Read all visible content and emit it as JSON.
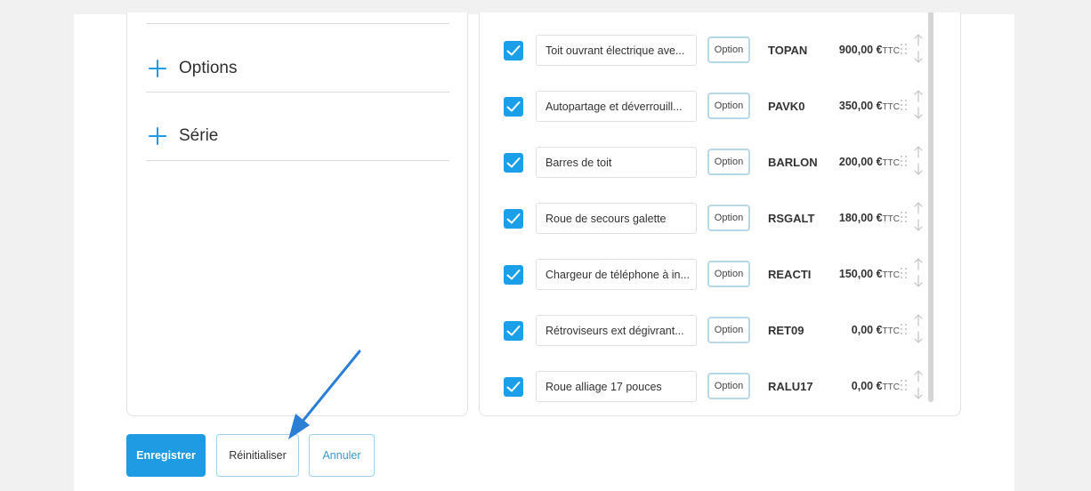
{
  "accordion": [
    {
      "label": "Options"
    },
    {
      "label": "Série"
    }
  ],
  "equipments": [
    {
      "checked": true,
      "name": "Toit ouvrant électrique ave...",
      "type": "Option",
      "code": "TOPAN",
      "price": "900,00 €",
      "unit": "TTC"
    },
    {
      "checked": true,
      "name": "Autopartage et déverrouill...",
      "type": "Option",
      "code": "PAVK0",
      "price": "350,00 €",
      "unit": "TTC"
    },
    {
      "checked": true,
      "name": "Barres de toit",
      "type": "Option",
      "code": "BARLON",
      "price": "200,00 €",
      "unit": "TTC"
    },
    {
      "checked": true,
      "name": "Roue de secours galette",
      "type": "Option",
      "code": "RSGALT",
      "price": "180,00 €",
      "unit": "TTC"
    },
    {
      "checked": true,
      "name": "Chargeur de téléphone à in...",
      "type": "Option",
      "code": "REACTI",
      "price": "150,00 €",
      "unit": "TTC"
    },
    {
      "checked": true,
      "name": "Rétroviseurs ext dégivrant...",
      "type": "Option",
      "code": "RET09",
      "price": "0,00 €",
      "unit": "TTC"
    },
    {
      "checked": true,
      "name": "Roue alliage 17 pouces",
      "type": "Option",
      "code": "RALU17",
      "price": "0,00 €",
      "unit": "TTC"
    }
  ],
  "actions": {
    "save_label": "Enregistrer",
    "reset_label": "Réinitialiser",
    "cancel_label": "Annuler"
  },
  "colors": {
    "accent": "#1f9be4",
    "annotation_arrow": "#2a7fd4"
  },
  "icons": {
    "expand": "plus-icon",
    "checkbox": "check-icon",
    "drag": "drag-handle-icon",
    "reorder": "up-down-arrows-icon"
  }
}
